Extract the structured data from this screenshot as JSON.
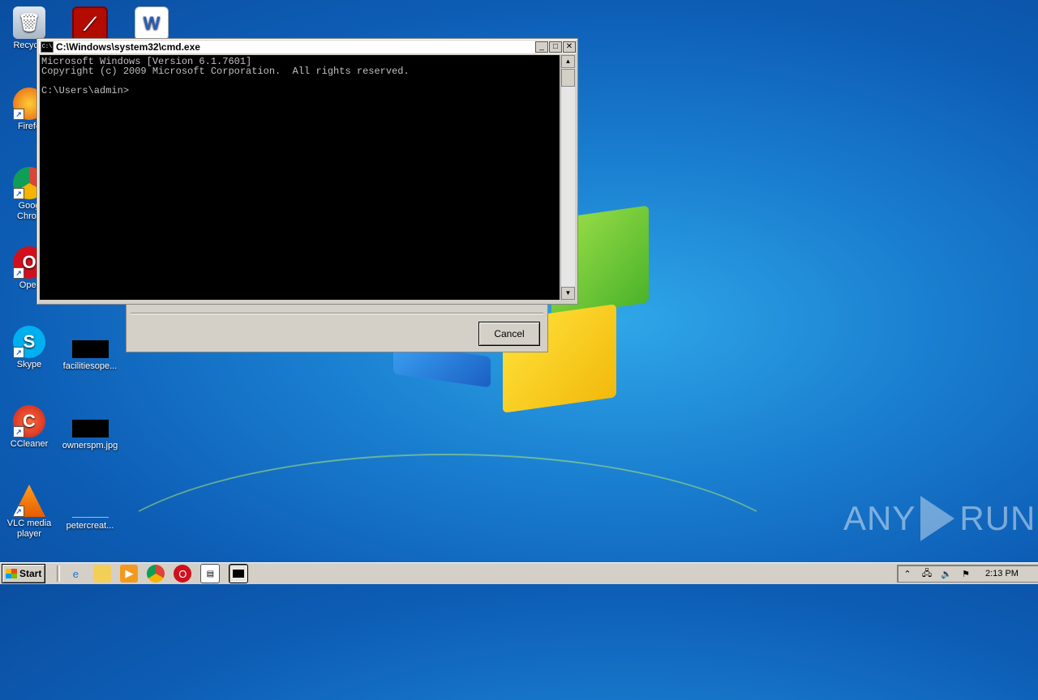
{
  "desktop": {
    "icons": [
      {
        "label": "Recycle",
        "icon": "recycle-bin-icon"
      },
      {
        "label": "",
        "icon": "acrobat-icon"
      },
      {
        "label": "",
        "icon": "word-icon"
      },
      {
        "label": "Firefo",
        "icon": "firefox-icon"
      },
      {
        "label": "Goog",
        "label2": "Chron",
        "icon": "chrome-icon"
      },
      {
        "label": "Oper",
        "icon": "opera-icon"
      },
      {
        "label": "Skype",
        "icon": "skype-icon"
      },
      {
        "label": "facilitiesope...",
        "icon": "file-thumbnail-icon"
      },
      {
        "label": "CCleaner",
        "icon": "ccleaner-icon"
      },
      {
        "label": "ownerspm.jpg",
        "icon": "image-file-icon"
      },
      {
        "label": "VLC media",
        "label2": "player",
        "icon": "vlc-icon"
      },
      {
        "label": "petercreat...",
        "icon": "blank-file-icon"
      }
    ]
  },
  "cmd": {
    "title": "C:\\Windows\\system32\\cmd.exe",
    "title_icon_text": "C:\\",
    "min_label": "_",
    "max_label": "□",
    "close_label": "✕",
    "output": "Microsoft Windows [Version 6.1.7601]\nCopyright (c) 2009 Microsoft Corporation.  All rights reserved.\n\nC:\\Users\\admin>"
  },
  "dialog": {
    "cancel_label": "Cancel"
  },
  "watermark": {
    "left_text": "ANY",
    "right_text": "RUN"
  },
  "taskbar": {
    "start_label": "Start",
    "quick_launch": [
      "ie-icon",
      "explorer-icon",
      "media-player-icon",
      "chrome-icon",
      "opera-icon",
      "task-icon",
      "cmd-icon"
    ],
    "clock": "2:13 PM"
  },
  "colors": {
    "desktop_blue": "#1a7fd0",
    "console_bg": "#000000",
    "console_fg": "#c0c0c0",
    "chrome": "#d4d0c8"
  }
}
